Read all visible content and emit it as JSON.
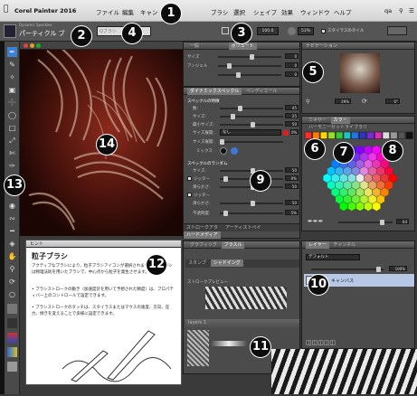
{
  "menubar": {
    "app_name": "Corel Painter 2016",
    "items": [
      "ファイル",
      "編集",
      "キャン",
      "",
      "ブラシ",
      "選択",
      "シェイプ",
      "効果",
      "ウィンドウ",
      "ヘルプ"
    ],
    "right_label": "qa"
  },
  "propbar": {
    "brush_category": "Dynamic Speckles",
    "brush_name": "パーティクル ブ",
    "search_placeholder": "Qブラシ",
    "size_value": "100.0",
    "opacity_value": "53%",
    "option_label": "スタイラスのタイル"
  },
  "general_panel": {
    "tabs": [
      "一般",
      "",
      "ボリュート"
    ],
    "rows": [
      {
        "label": "サイズ",
        "value": "0"
      },
      {
        "label": "アンジェル",
        "value": "0"
      },
      {
        "label": "",
        "value": "0"
      }
    ]
  },
  "dynamic_panel": {
    "tabs": [
      "ダイナミックスペックル",
      "ペンディエール"
    ],
    "section1": "スペックルの特徴",
    "rows1": [
      {
        "label": "数:",
        "value": "45"
      },
      {
        "label": "サイズ:",
        "value": "25"
      },
      {
        "label": "最小サイズ:",
        "value": "50"
      },
      {
        "label": "最小サイズ:",
        "value": "0%"
      }
    ],
    "dropdown_label": "サイズ展開:",
    "dropdown_value": "なし",
    "extra_label": "サイズ展開:",
    "color_label": "ミックス",
    "section2": "スペックルのランダム",
    "rows2": [
      {
        "label": "サイズ:",
        "value": "50"
      },
      {
        "label": "ジッター",
        "value": "0%"
      },
      {
        "label": "滑らかさ:",
        "value": "50"
      }
    ],
    "section3": "ジッター",
    "rows3": [
      {
        "label": "滑らかさ:",
        "value": "50"
      },
      {
        "label": "不透明度:",
        "value": "5%"
      }
    ],
    "bottom_tabs": [
      "ストロークアタ",
      "アーティストペイ",
      "ハードメディア"
    ]
  },
  "brush_panel": {
    "tabs": [
      "グラフィック",
      "ブラスル"
    ],
    "sub_tabs": [
      "スタンプ",
      "シャドイング"
    ],
    "stroke_preview_label": "ストロークプレビュー",
    "layers_title": "layers 1"
  },
  "navigator": {
    "title": "ナビゲーション",
    "zoom": "29%",
    "angle": "0°"
  },
  "color_panel": {
    "tabs": [
      "ミキサー",
      "カラー",
      "ハーモニーセットライブラリ"
    ],
    "size_value": "64",
    "swatch_colors": [
      "#ff2a2a",
      "#ff7a00",
      "#ffd800",
      "#9adf1f",
      "#33cc33",
      "#1ec4c4",
      "#1e77e6",
      "#2b34c9",
      "#7a2ad6",
      "#e02ab3",
      "#dddddd",
      "#999999",
      "#555555",
      "#111111"
    ]
  },
  "layers_panel": {
    "tabs": [
      "レイヤー",
      "チャンネル"
    ],
    "blend_mode": "デフォルト",
    "opacity": "100%",
    "layer_name": "キャンバス"
  },
  "help_panel": {
    "tab": "ヒント",
    "heading": "粒子ブラシ",
    "paragraph": "アクティブなブラシにより、粒子ブラシアイコンが選択されます。粒子ブラシは物理法則を用いたブラシで、中心点から粒子を発生させます。",
    "bullet1": "ブラシストロークの動き（加速度計を用いて予想された精度）は、プロパティバー上のコントロールで設定できます。",
    "bullet2": "ブラシストロークのタッチは、スタイラスまたはマウスの速度、方向、圧力、傾きを変えることで多様に設定できます。"
  },
  "callouts": [
    "1",
    "2",
    "3",
    "4",
    "5",
    "6",
    "7",
    "8",
    "9",
    "10",
    "11",
    "12",
    "13",
    "14"
  ]
}
